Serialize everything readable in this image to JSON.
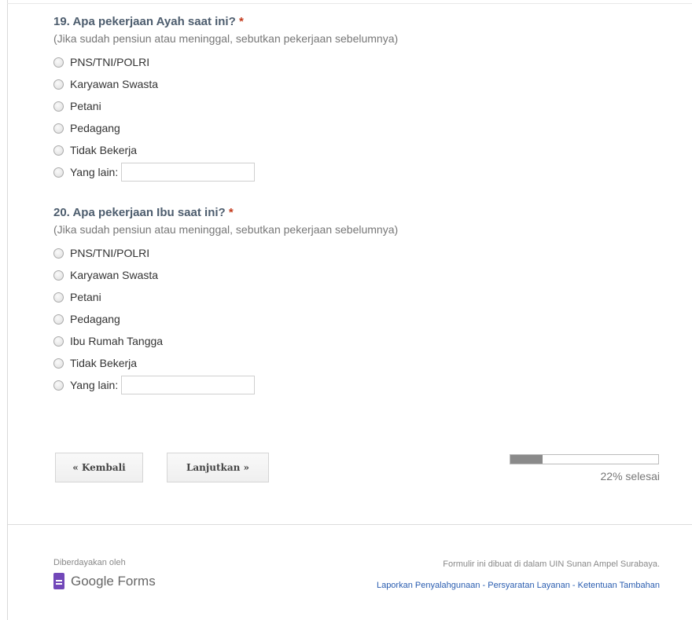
{
  "q19": {
    "title": "19. Apa pekerjaan Ayah saat ini?",
    "required_mark": "*",
    "help": "(Jika sudah pensiun atau meninggal, sebutkan pekerjaan sebelumnya)",
    "options": [
      "PNS/TNI/POLRI",
      "Karyawan Swasta",
      "Petani",
      "Pedagang",
      "Tidak Bekerja"
    ],
    "other_label": "Yang lain:",
    "other_value": ""
  },
  "q20": {
    "title": "20. Apa pekerjaan Ibu saat ini?",
    "required_mark": "*",
    "help": "(Jika sudah pensiun atau meninggal, sebutkan pekerjaan sebelumnya)",
    "options": [
      "PNS/TNI/POLRI",
      "Karyawan Swasta",
      "Petani",
      "Pedagang",
      "Ibu Rumah Tangga",
      "Tidak Bekerja"
    ],
    "other_label": "Yang lain:",
    "other_value": ""
  },
  "nav": {
    "back_label": "« Kembali",
    "next_label": "Lanjutkan »"
  },
  "progress": {
    "percent": 22,
    "label": "22% selesai"
  },
  "footer": {
    "powered_by": "Diberdayakan oleh",
    "brand": "Google Forms",
    "created_in": "Formulir ini dibuat di dalam UIN Sunan Ampel Surabaya.",
    "link_report": "Laporkan Penyalahgunaan",
    "link_terms": "Persyaratan Layanan",
    "link_additional": "Ketentuan Tambahan",
    "separator": " - "
  },
  "colors": {
    "question_title": "#4d5d6e",
    "required": "#c43b1d",
    "link": "#2a5db0",
    "progress_fill": "#8a8a8a",
    "brand_icon": "#7248b9"
  }
}
